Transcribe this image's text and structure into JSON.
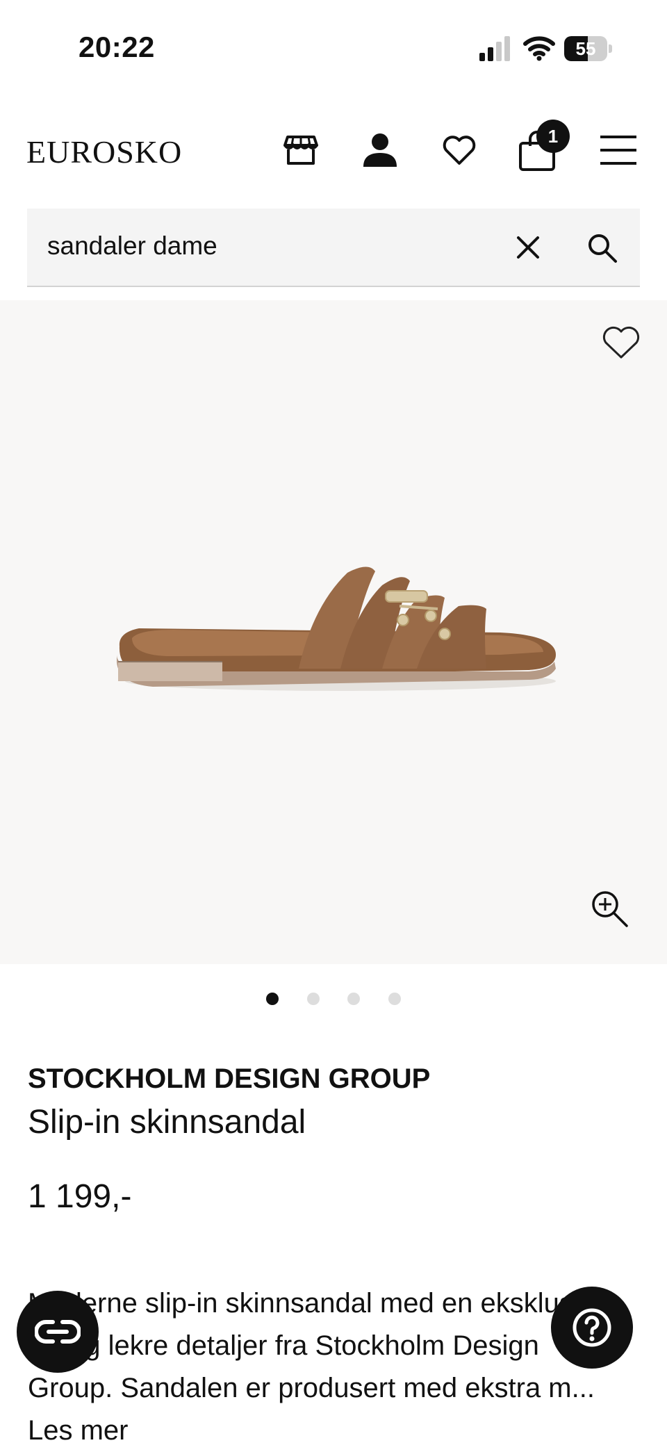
{
  "status_bar": {
    "time": "20:22",
    "battery": "55",
    "battery_level": 0.55
  },
  "header": {
    "logo": "EUROSKO",
    "icons": [
      "store-icon",
      "user-icon",
      "heart-icon",
      "bag-icon",
      "menu-icon"
    ],
    "cart_count": "1"
  },
  "search": {
    "value": "sandaler dame",
    "placeholder": ""
  },
  "gallery": {
    "image_count": 4,
    "active_index": 0
  },
  "product": {
    "brand": "STOCKHOLM DESIGN GROUP",
    "title": "Slip-in skinnsandal",
    "price": "1 199,-",
    "description_lines": [
      "Moderne slip-in skinnsandal med en eksklusiv",
      "stil og lekre detaljer fra Stockholm Design",
      "Group. Sandalen er produsert med ekstra m..."
    ],
    "read_more": "Les mer"
  },
  "colors": {
    "text": "#111111",
    "image_bg": "#f8f7f6",
    "search_bg": "#f4f4f4",
    "shoe": "#9a6b48"
  }
}
